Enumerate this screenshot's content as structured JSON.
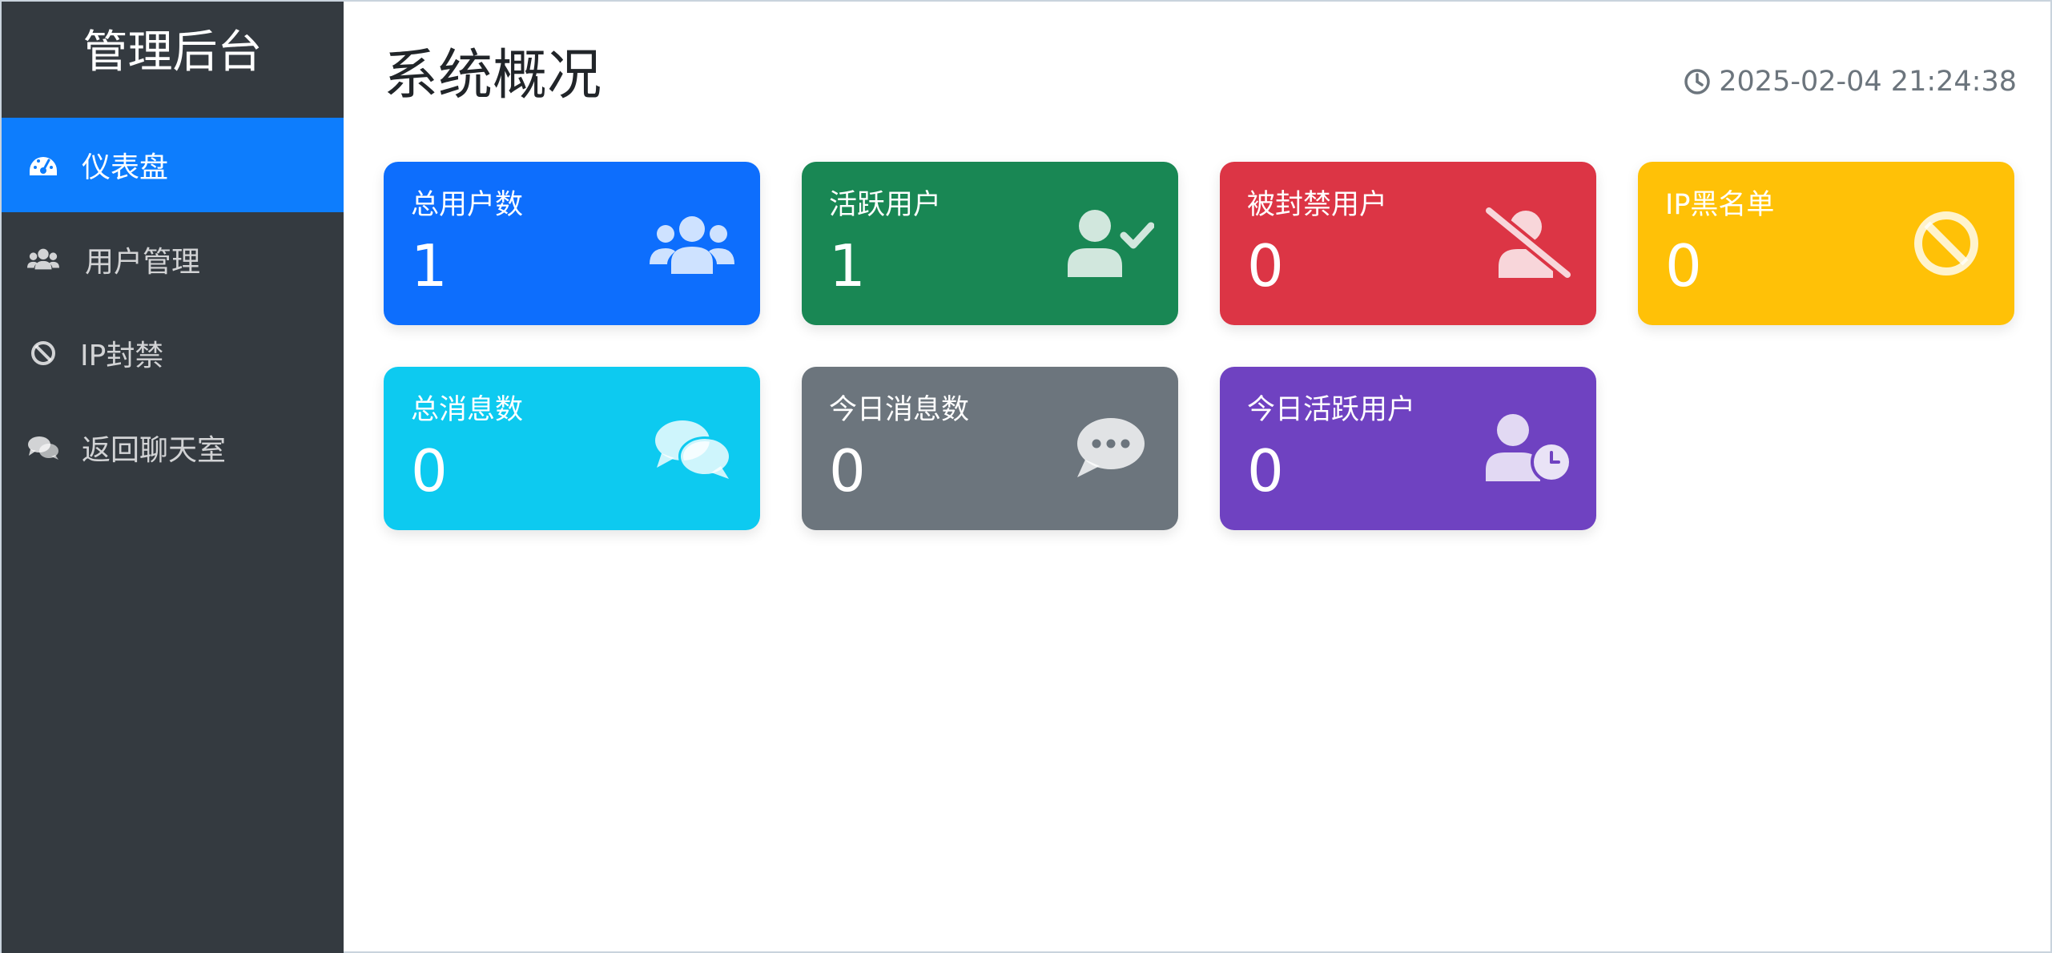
{
  "sidebar": {
    "title": "管理后台",
    "items": [
      {
        "label": "仪表盘",
        "icon": "dashboard-gauge-icon",
        "active": true
      },
      {
        "label": "用户管理",
        "icon": "users-icon",
        "active": false
      },
      {
        "label": "IP封禁",
        "icon": "ban-icon",
        "active": false
      },
      {
        "label": "返回聊天室",
        "icon": "comments-icon",
        "active": false
      }
    ]
  },
  "header": {
    "title": "系统概况",
    "timestamp": "2025-02-04 21:24:38",
    "timestamp_icon": "clock-icon"
  },
  "cards": [
    {
      "label": "总用户数",
      "value": "1",
      "icon": "users-icon",
      "color": "#0d6efd"
    },
    {
      "label": "活跃用户",
      "value": "1",
      "icon": "user-check-icon",
      "color": "#198754"
    },
    {
      "label": "被封禁用户",
      "value": "0",
      "icon": "user-slash-icon",
      "color": "#dc3545"
    },
    {
      "label": "IP黑名单",
      "value": "0",
      "icon": "ban-icon",
      "color": "#ffc107"
    },
    {
      "label": "总消息数",
      "value": "0",
      "icon": "comments-icon",
      "color": "#0dcaf0"
    },
    {
      "label": "今日消息数",
      "value": "0",
      "icon": "comment-dots-icon",
      "color": "#6c757d"
    },
    {
      "label": "今日活跃用户",
      "value": "0",
      "icon": "user-clock-icon",
      "color": "#6f42c1"
    }
  ],
  "colors": {
    "sidebar_bg": "#343a40",
    "active_nav": "#0d7dfd",
    "text_muted": "#6c757d"
  }
}
